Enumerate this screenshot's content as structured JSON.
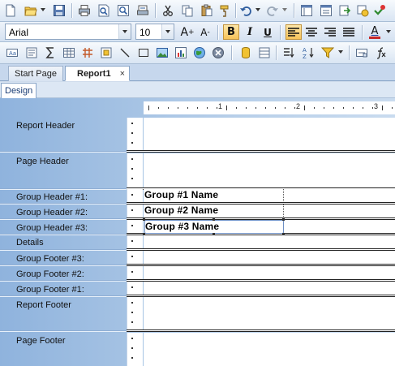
{
  "toolbar_font": {
    "font_name": "Arial",
    "font_size": "10",
    "bold_label": "B",
    "italic_label": "I",
    "underline_label": "U",
    "grow_label": "A",
    "grow_mark": "+",
    "shrink_label": "A",
    "shrink_mark": "-",
    "color_label": "A",
    "colors": {
      "accent": "#f6c35a",
      "font_color_bar": "#c62828"
    }
  },
  "tabs": {
    "start_page": "Start Page",
    "report": "Report1",
    "close": "×"
  },
  "subtabs": {
    "design": "Design"
  },
  "ruler": {
    "marks": [
      "1",
      "2",
      "3"
    ]
  },
  "bands": [
    {
      "label": "Report Header"
    },
    {
      "label": "Page Header"
    },
    {
      "label": "Group Header #1:"
    },
    {
      "label": "Group Header #2:"
    },
    {
      "label": "Group Header #3:"
    },
    {
      "label": "Details"
    },
    {
      "label": "Group Footer #3:"
    },
    {
      "label": "Group Footer #2:"
    },
    {
      "label": "Group Footer #1:"
    },
    {
      "label": "Report Footer"
    },
    {
      "label": "Page Footer"
    }
  ],
  "fields": [
    {
      "text": "Group #1 Name"
    },
    {
      "text": "Group #2 Name"
    },
    {
      "text": "Group #3 Name"
    }
  ]
}
